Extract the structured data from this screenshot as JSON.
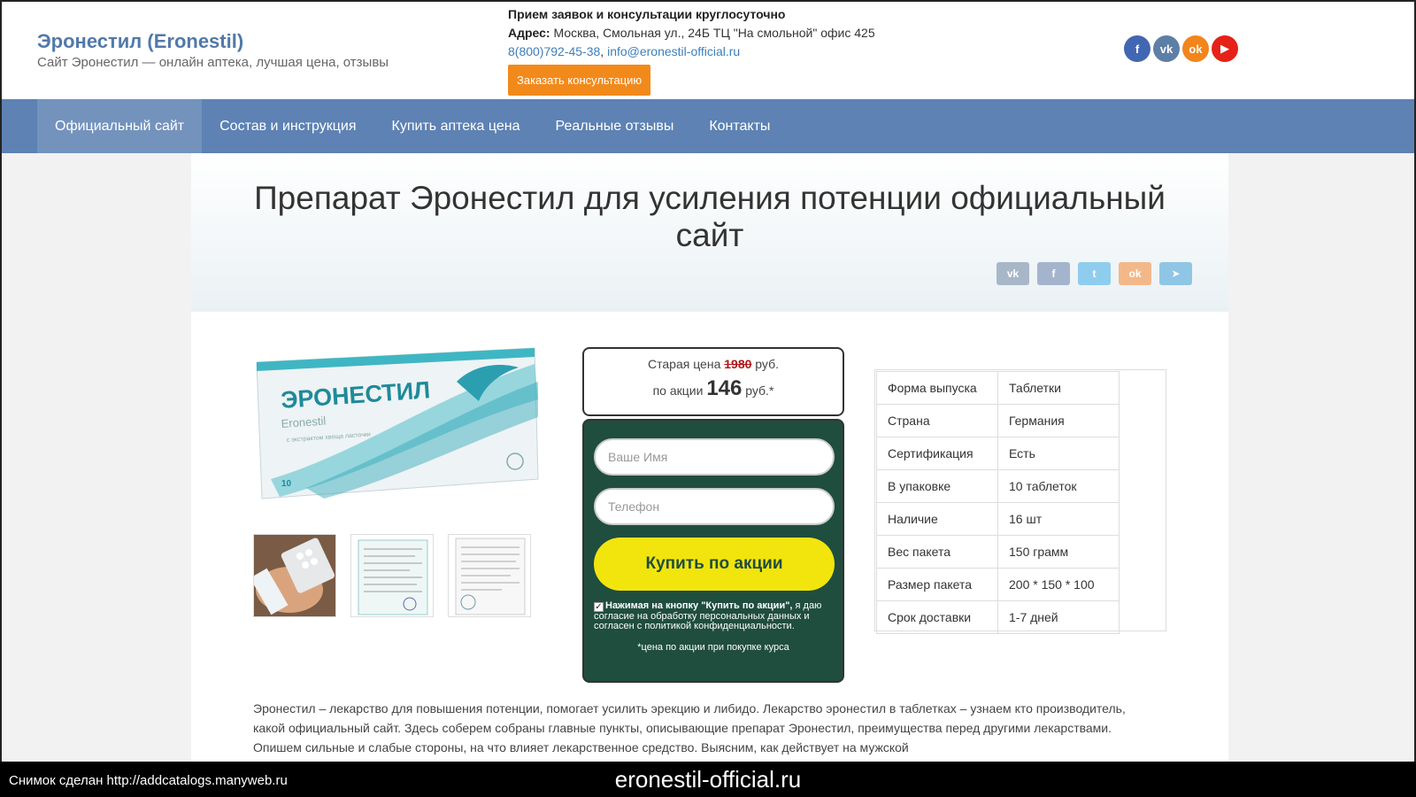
{
  "header": {
    "site_title": "Эронестил (Eronestil)",
    "site_description": "Сайт Эронестил — онлайн аптека, лучшая цена, отзывы",
    "contacts": {
      "hours": "Прием заявок и консультации круглосуточно",
      "address_label": "Адрес:",
      "address": "Москва, Смольная ул., 24Б ТЦ \"На смольной\" офис 425",
      "phone": "8(800)792-45-38",
      "separator": ",",
      "email": "info@eronestil-official.ru",
      "consult_button": "Заказать консультацию"
    },
    "socials": [
      {
        "icon": "facebook-icon",
        "glyph": "f",
        "color": "#4267b2"
      },
      {
        "icon": "vk-icon",
        "glyph": "vk",
        "color": "#5d7fa6"
      },
      {
        "icon": "odnoklassniki-icon",
        "glyph": "ok",
        "color": "#f2851b"
      },
      {
        "icon": "youtube-icon",
        "glyph": "▶",
        "color": "#e62117"
      }
    ]
  },
  "nav": {
    "items": [
      {
        "label": "Официальный сайт",
        "active": true
      },
      {
        "label": "Состав и инструкция",
        "active": false
      },
      {
        "label": "Купить аптека цена",
        "active": false
      },
      {
        "label": "Реальные отзывы",
        "active": false
      },
      {
        "label": "Контакты",
        "active": false
      }
    ]
  },
  "page": {
    "title": "Препарат Эронестил для усиления потенции официальный сайт",
    "share": [
      {
        "icon": "vk-icon",
        "glyph": "vk",
        "color": "#a8b7c8"
      },
      {
        "icon": "facebook-icon",
        "glyph": "f",
        "color": "#a5b4cd"
      },
      {
        "icon": "twitter-icon",
        "glyph": "t",
        "color": "#8fcdee"
      },
      {
        "icon": "odnoklassniki-icon",
        "glyph": "ok",
        "color": "#f3b88a"
      },
      {
        "icon": "telegram-icon",
        "glyph": "➤",
        "color": "#8fc6e6"
      }
    ]
  },
  "product": {
    "box_brand": "ЭРОНЕСТИЛ",
    "box_latin": "Eronestil",
    "box_sub": "с экстрактом хвоща ласточки",
    "box_count": "10"
  },
  "price": {
    "old_label": "Старая цена",
    "old_value": "1980",
    "old_currency": "руб.",
    "new_label": "по акции",
    "new_value": "146",
    "new_currency": "руб.*"
  },
  "order_form": {
    "name_placeholder": "Ваше Имя",
    "phone_placeholder": "Телефон",
    "buy_button": "Купить по акции",
    "consent_bold": "Нажимая на кнопку \"Купить по акции\",",
    "consent_text": " я даю согласие на обработку персональных данных и согласен с политикой конфиденциальности.",
    "price_note": "*цена по акции при покупке курса"
  },
  "specs": [
    {
      "key": "Форма выпуска",
      "value": "Таблетки"
    },
    {
      "key": "Страна",
      "value": "Германия"
    },
    {
      "key": "Сертификация",
      "value": "Есть"
    },
    {
      "key": "В упаковке",
      "value": "10 таблеток"
    },
    {
      "key": "Наличие",
      "value": "16 шт"
    },
    {
      "key": "Вес пакета",
      "value": "150 грамм"
    },
    {
      "key": "Размер пакета",
      "value": "200 * 150 * 100"
    },
    {
      "key": "Срок доставки",
      "value": "1-7 дней"
    }
  ],
  "description": "Эронестил – лекарство для повышения потенции, помогает усилить эрекцию и либидо. Лекарство эронестил в таблетках – узнаем кто производитель, какой официальный сайт. Здесь соберем собраны главные пункты, описывающие препарат Эронестил, преимущества перед другими лекарствами. Опишем сильные и слабые стороны, на что влияет лекарственное средство. Выясним, как действует на мужской",
  "footer_bar": {
    "caption": "Снимок сделан http://addcatalogs.manyweb.ru",
    "domain": "eronestil-official.ru"
  }
}
